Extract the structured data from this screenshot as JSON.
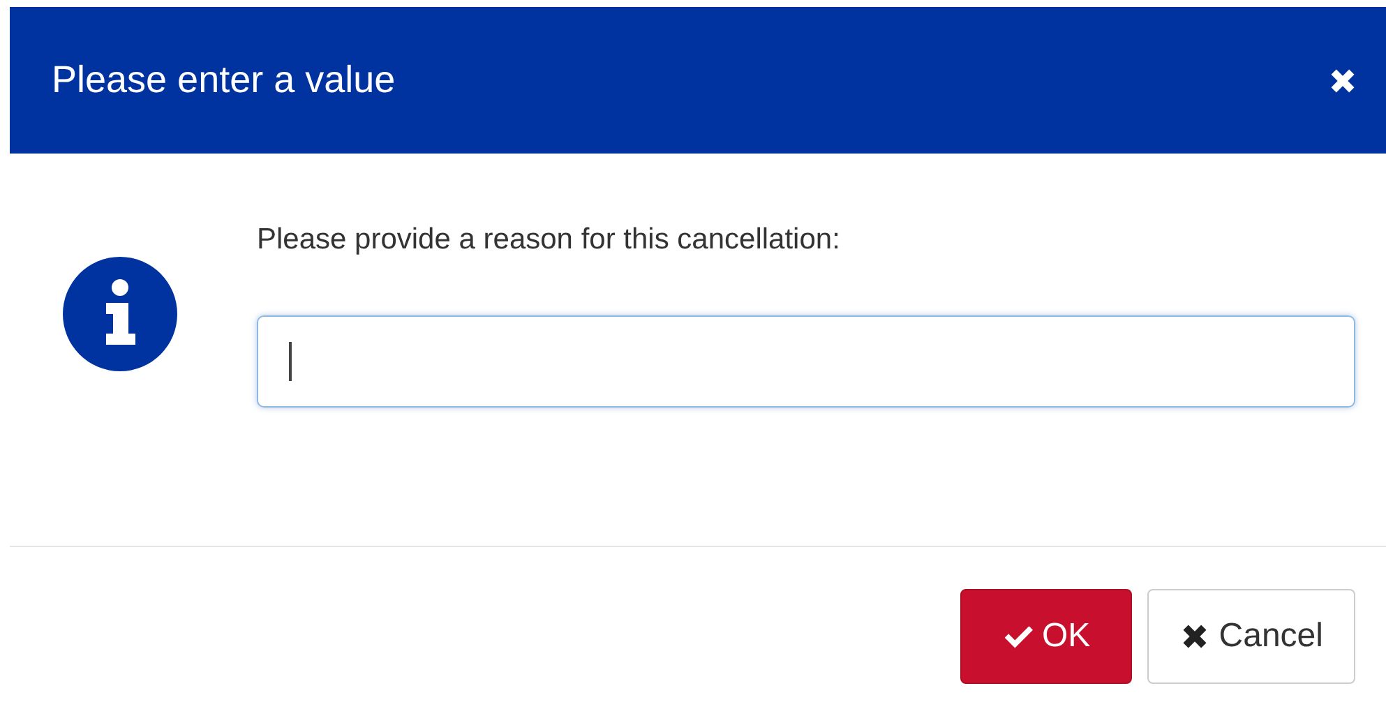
{
  "dialog": {
    "title": "Please enter a value",
    "prompt": "Please provide a reason for this cancellation:",
    "field": {
      "focused": true
    },
    "buttons": [
      {
        "kind": "primary",
        "label": "OK"
      },
      {
        "kind": "secondary",
        "label": "Cancel"
      }
    ]
  }
}
